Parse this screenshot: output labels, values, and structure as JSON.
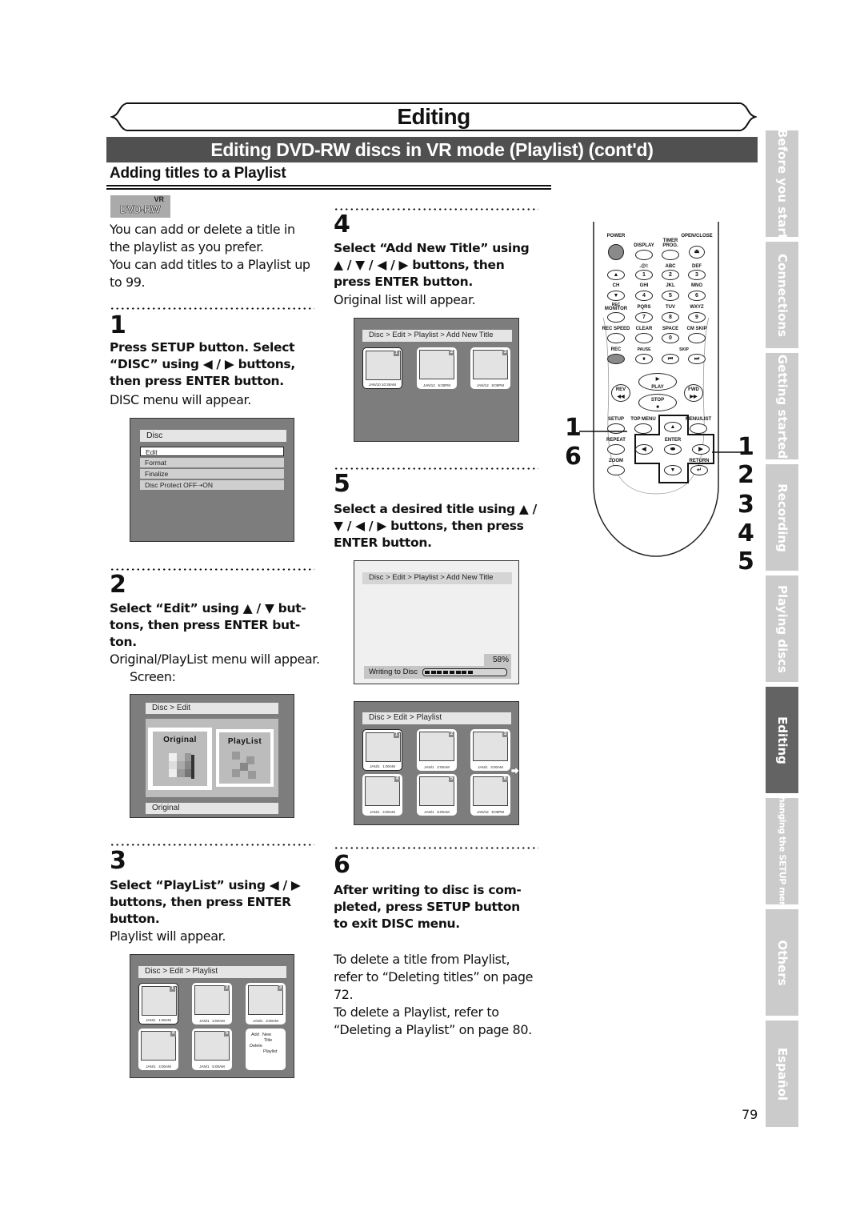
{
  "header": {
    "chapter_title": "Editing",
    "section_title": "Editing DVD-RW discs in VR mode (Playlist) (cont'd)",
    "subsection_title": "Adding titles to a Playlist"
  },
  "badge": {
    "top": "VR",
    "main": "DVD-RW"
  },
  "intro": {
    "lines": [
      "You can add or delete a title in",
      "the playlist as you prefer.",
      "You can add titles to a Playlist up",
      "to 99."
    ]
  },
  "steps": [
    {
      "number": "1",
      "instruction": [
        "Press SETUP button. Select",
        "“DISC” using ◀ / ▶ buttons,",
        "then press ENTER button."
      ],
      "result": "DISC menu will appear.",
      "screen": {
        "title": "Disc",
        "items": [
          "Edit",
          "Format",
          "Finalize",
          "Disc Protect OFF➝ON"
        ],
        "selected_index": 0
      }
    },
    {
      "number": "2",
      "instruction": [
        "Select “Edit” using ▲ / ▼ but-",
        "tons, then press ENTER but-",
        "ton."
      ],
      "result": "Original/PlayList menu will appear.",
      "result2": "Screen:",
      "screen": {
        "crumb": "Disc > Edit",
        "options": [
          "Original",
          "PlayList"
        ],
        "selected": "Original",
        "status": "Original"
      }
    },
    {
      "number": "3",
      "instruction": [
        "Select “PlayList” using ◀ / ▶",
        "buttons, then press ENTER",
        "button."
      ],
      "result": "Playlist will appear.",
      "screen": {
        "crumb": "Disc > Edit > Playlist",
        "titles": [
          {
            "num": "1",
            "time": "JAN/1   1:00AM",
            "selected": true
          },
          {
            "num": "2",
            "time": "JAN/1   2:00AM"
          },
          {
            "num": "3",
            "time": "JAN/1   3:00AM"
          },
          {
            "num": "4",
            "time": "JAN/1   4:00AM"
          },
          {
            "num": "5",
            "time": "JAN/1   5:00AM"
          }
        ],
        "menu_options": [
          "Add",
          "New",
          "Title",
          "Delete",
          "Playlist"
        ]
      }
    },
    {
      "number": "4",
      "instruction": [
        "Select “Add New Title” using",
        "▲ / ▼ / ◀ / ▶ buttons, then",
        "press ENTER button."
      ],
      "result": "Original list will appear.",
      "screen": {
        "crumb": "Disc > Edit > Playlist > Add New Title",
        "titles": [
          {
            "num": "1",
            "time": "JAN/10 10:30AM",
            "selected": true
          },
          {
            "num": "2",
            "time": "JAN/12   5:00PM"
          },
          {
            "num": "3",
            "time": "JAN/12   8:00PM"
          }
        ]
      }
    },
    {
      "number": "5",
      "instruction": [
        "Select a desired title using ▲ /",
        "▼ / ◀ / ▶ buttons, then press",
        "ENTER button."
      ],
      "screen": {
        "crumb": "Disc > Edit > Playlist > Add New Title",
        "progress_label": "Writing to Disc",
        "progress_percent": "58%",
        "progress_value": 0.58
      },
      "screen2": {
        "crumb": "Disc > Edit > Playlist",
        "titles": [
          {
            "num": "1",
            "time": "JAN/1   1:00AM",
            "selected": true
          },
          {
            "num": "2",
            "time": "JAN/1   2:00AM"
          },
          {
            "num": "3",
            "time": "JAN/1   3:00AM"
          },
          {
            "num": "4",
            "time": "JAN/1   4:00AM"
          },
          {
            "num": "5",
            "time": "JAN/1   5:00AM"
          },
          {
            "num": "6",
            "time": "JAN/12   8:00PM"
          }
        ]
      }
    },
    {
      "number": "6",
      "instruction": [
        "After writing to disc is com-",
        "pleted, press SETUP button",
        "to exit DISC menu."
      ],
      "notes": [
        "To delete a title from Playlist,",
        "refer to “Deleting titles” on page",
        "72.",
        "To delete a Playlist, refer to",
        "“Deleting a Playlist” on page 80."
      ]
    }
  ],
  "remote": {
    "labels": {
      "power": "POWER",
      "display": "DISPLAY",
      "timer": "TIMER",
      "prog": "PROG.",
      "open_close": "OPEN/CLOSE",
      "sym": ".@/:",
      "abc": "ABC",
      "def": "DEF",
      "ch": "CH",
      "ghi": "GHI",
      "jkl": "JKL",
      "mno": "MNO",
      "rec": "REC",
      "monitor": "MONITOR",
      "pqrs": "PQRS",
      "tuv": "TUV",
      "wxyz": "WXYZ",
      "rec_speed": "REC SPEED",
      "clear": "CLEAR",
      "space": "SPACE",
      "cm_skip": "CM SKIP",
      "rec_btn": "REC",
      "pause": "PAUSE",
      "skip": "SKIP",
      "play": "PLAY",
      "rev": "REV",
      "fwd": "FWD",
      "stop": "STOP",
      "setup": "SETUP",
      "top_menu": "TOP MENU",
      "menu_list": "MENU/LIST",
      "repeat": "REPEAT",
      "enter": "ENTER",
      "zoom": "ZOOM",
      "return": "RETURN"
    },
    "digits": [
      "1",
      "2",
      "3",
      "4",
      "5",
      "6",
      "7",
      "8",
      "9",
      "0"
    ],
    "callouts_left": [
      "1",
      "6"
    ],
    "callouts_right": [
      "1",
      "2",
      "3",
      "4",
      "5"
    ]
  },
  "side_tabs": [
    {
      "label": "Before you start"
    },
    {
      "label": "Connections"
    },
    {
      "label": "Getting started"
    },
    {
      "label": "Recording"
    },
    {
      "label": "Playing discs"
    },
    {
      "label": "Editing",
      "active": true
    },
    {
      "label": "Changing the SETUP menu"
    },
    {
      "label": "Others"
    },
    {
      "label": "Español"
    }
  ],
  "page_number": "79"
}
